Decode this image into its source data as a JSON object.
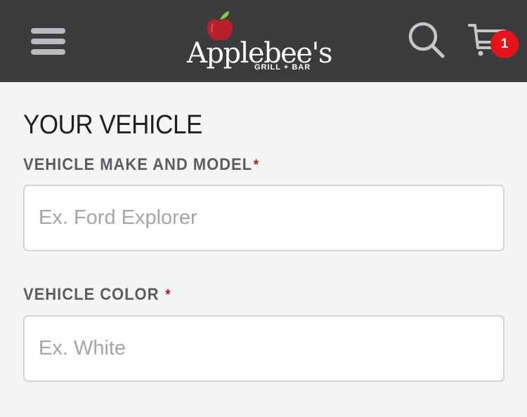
{
  "header": {
    "logo": {
      "wordmark": "Applebee's",
      "tagline": "GRILL + BAR"
    },
    "icons": {
      "menu": "hamburger-menu-icon",
      "search": "search-icon",
      "cart": "cart-icon"
    },
    "cart_count": "1",
    "colors": {
      "background": "#3b3c3e",
      "badge": "#e5141a",
      "apple": "#b8202a",
      "leaf": "#8dc63f"
    }
  },
  "vehicle_section": {
    "title": "YOUR VEHICLE",
    "required_marker": "*",
    "make_model": {
      "label": "VEHICLE MAKE AND MODEL",
      "placeholder": "Ex. Ford Explorer",
      "value": ""
    },
    "color": {
      "label": "VEHICLE COLOR ",
      "placeholder": "Ex. White",
      "value": ""
    }
  }
}
